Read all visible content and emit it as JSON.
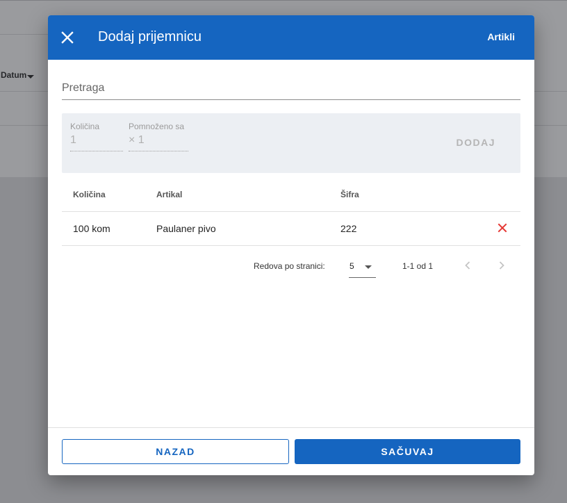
{
  "background": {
    "column_header": "Datum"
  },
  "dialog": {
    "title": "Dodaj prijemnicu",
    "header_action": "Artikli",
    "search": {
      "placeholder": "Pretraga",
      "value": ""
    },
    "entry": {
      "quantity_label": "Količina",
      "quantity_value": "1",
      "multiplier_label": "Pomnoženo sa",
      "multiplier_value": "× 1",
      "add_label": "DODAJ"
    },
    "table": {
      "headers": [
        "Količina",
        "Artikal",
        "Šifra"
      ],
      "rows": [
        {
          "quantity": "100 kom",
          "article": "Paulaner pivo",
          "code": "222"
        }
      ]
    },
    "pagination": {
      "rows_per_page_label": "Redova po stranici:",
      "rows_per_page_value": "5",
      "range": "1-1 od 1"
    },
    "footer": {
      "back_label": "NAZAD",
      "save_label": "SAČUVAJ"
    }
  },
  "colors": {
    "primary": "#1565c0",
    "delete": "#e53935",
    "overlay": "#8f9094"
  },
  "icons": {
    "close": "close-icon",
    "delete": "delete-icon",
    "prev": "chevron-left-icon",
    "next": "chevron-right-icon",
    "dropdown": "arrow-drop-down-icon"
  }
}
